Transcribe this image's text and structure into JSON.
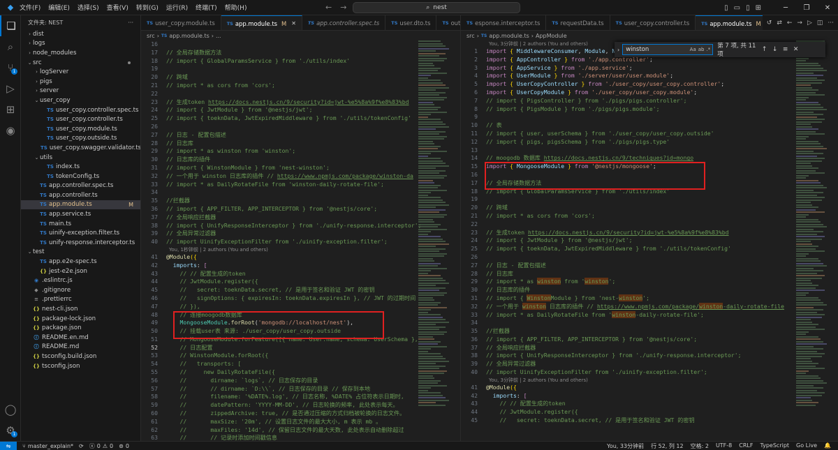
{
  "menu": [
    "文件(F)",
    "编辑(E)",
    "选择(S)",
    "查看(V)",
    "转到(G)",
    "运行(R)",
    "终端(T)",
    "帮助(H)"
  ],
  "search": {
    "text": "nest"
  },
  "explorer": {
    "title": "文件夹: NEST",
    "items": [
      {
        "label": "dist",
        "depth": 0,
        "kind": "folder",
        "open": false
      },
      {
        "label": "logs",
        "depth": 0,
        "kind": "folder",
        "open": false
      },
      {
        "label": "node_modules",
        "depth": 0,
        "kind": "folder",
        "open": false
      },
      {
        "label": "src",
        "depth": 0,
        "kind": "folder",
        "open": true,
        "dot": true
      },
      {
        "label": "logServer",
        "depth": 1,
        "kind": "folder",
        "open": false
      },
      {
        "label": "pigs",
        "depth": 1,
        "kind": "folder",
        "open": false
      },
      {
        "label": "server",
        "depth": 1,
        "kind": "folder",
        "open": false
      },
      {
        "label": "user_copy",
        "depth": 1,
        "kind": "folder",
        "open": true
      },
      {
        "label": "user_copy.controller.spec.ts",
        "depth": 2,
        "kind": "ts"
      },
      {
        "label": "user_copy.controller.ts",
        "depth": 2,
        "kind": "ts"
      },
      {
        "label": "user_copy.module.ts",
        "depth": 2,
        "kind": "ts"
      },
      {
        "label": "user_copy.outside.ts",
        "depth": 2,
        "kind": "ts"
      },
      {
        "label": "user_copy.swagger.validator.ts",
        "depth": 2,
        "kind": "ts"
      },
      {
        "label": "utils",
        "depth": 1,
        "kind": "folder",
        "open": true
      },
      {
        "label": "index.ts",
        "depth": 2,
        "kind": "ts"
      },
      {
        "label": "tokenConfig.ts",
        "depth": 2,
        "kind": "ts"
      },
      {
        "label": "app.controller.spec.ts",
        "depth": 1,
        "kind": "ts"
      },
      {
        "label": "app.controller.ts",
        "depth": 1,
        "kind": "ts"
      },
      {
        "label": "app.module.ts",
        "depth": 1,
        "kind": "ts",
        "selected": true,
        "flag": "M"
      },
      {
        "label": "app.service.ts",
        "depth": 1,
        "kind": "ts"
      },
      {
        "label": "main.ts",
        "depth": 1,
        "kind": "ts"
      },
      {
        "label": "uinify-exception.filter.ts",
        "depth": 1,
        "kind": "ts"
      },
      {
        "label": "unify-response.interceptor.ts",
        "depth": 1,
        "kind": "ts"
      },
      {
        "label": "test",
        "depth": 0,
        "kind": "folder",
        "open": true
      },
      {
        "label": "app.e2e-spec.ts",
        "depth": 1,
        "kind": "ts"
      },
      {
        "label": "jest-e2e.json",
        "depth": 1,
        "kind": "json"
      },
      {
        "label": ".eslintrc.js",
        "depth": 0,
        "kind": "eslint"
      },
      {
        "label": ".gitignore",
        "depth": 0,
        "kind": "git"
      },
      {
        "label": ".prettierrc",
        "depth": 0,
        "kind": "prettier"
      },
      {
        "label": "nest-cli.json",
        "depth": 0,
        "kind": "json"
      },
      {
        "label": "package-lock.json",
        "depth": 0,
        "kind": "json"
      },
      {
        "label": "package.json",
        "depth": 0,
        "kind": "json"
      },
      {
        "label": "README.en.md",
        "depth": 0,
        "kind": "md"
      },
      {
        "label": "README.md",
        "depth": 0,
        "kind": "md"
      },
      {
        "label": "tsconfig.build.json",
        "depth": 0,
        "kind": "json"
      },
      {
        "label": "tsconfig.json",
        "depth": 0,
        "kind": "json"
      }
    ]
  },
  "left_editor": {
    "tabs": [
      {
        "label": "user_copy.module.ts",
        "active": false,
        "italic": false
      },
      {
        "label": "app.module.ts",
        "active": true,
        "modified": "M"
      },
      {
        "label": "app.controller.spec.ts",
        "active": false,
        "italic": true
      },
      {
        "label": "user.dto.ts",
        "active": false
      },
      {
        "label": "outsid",
        "active": false
      }
    ],
    "breadcrumb": [
      "src",
      "app.module.ts",
      "..."
    ],
    "codelens": "You, 1秒钟前 | 2 authors (You and others)",
    "lines": [
      {
        "n": "16",
        "html": ""
      },
      {
        "n": "17",
        "html": "<span class='c'>// 全局存储数据方法</span>"
      },
      {
        "n": "18",
        "html": "<span class='c'>// import { GlobalParamsService } from './utils/index'</span>"
      },
      {
        "n": "19",
        "html": ""
      },
      {
        "n": "20",
        "html": "<span class='c'>// 跨域</span>"
      },
      {
        "n": "21",
        "html": "<span class='c'>// import * as cors from 'cors';</span>"
      },
      {
        "n": "22",
        "html": ""
      },
      {
        "n": "23",
        "html": "<span class='c'>// 生成token </span><span class='u'>https://docs.nestjs.cn/9/security?id=jwt-%e5%8a%9f%e8%83%bd</span>"
      },
      {
        "n": "24",
        "html": "<span class='c'>// import { JwtModule } from '@nestjs/jwt';</span>"
      },
      {
        "n": "25",
        "html": "<span class='c'>// import { toeknData, JwtExpiredMiddleware } from './utils/tokenConfig'</span>"
      },
      {
        "n": "26",
        "html": ""
      },
      {
        "n": "27",
        "html": "<span class='c'>// 日志 - 配置包描述</span>"
      },
      {
        "n": "28",
        "html": "<span class='c'>// 日志库</span>"
      },
      {
        "n": "29",
        "html": "<span class='c'>// import * as winston from 'winston';</span>"
      },
      {
        "n": "30",
        "html": "<span class='c'>// 日志库的插件</span>"
      },
      {
        "n": "31",
        "html": "<span class='c'>// import { WinstonModule } from 'nest-winston';</span>"
      },
      {
        "n": "32",
        "html": "<span class='c'>// 一个用于 winston 日志库的插件 // </span><span class='u'>https://www.npmjs.com/package/winston-da</span>"
      },
      {
        "n": "33",
        "html": "<span class='c'>// import * as DailyRotateFile from 'winston-daily-rotate-file';</span>"
      },
      {
        "n": "34",
        "html": ""
      },
      {
        "n": "35",
        "html": "<span class='c'>//拦截器</span>"
      },
      {
        "n": "36",
        "html": "<span class='c'>// import { APP_FILTER, APP_INTERCEPTOR } from '@nestjs/core';</span>"
      },
      {
        "n": "37",
        "html": "<span class='c'>// 全局响应拦截器</span>"
      },
      {
        "n": "38",
        "html": "<span class='c'>// import { UnifyResponseInterceptor } from './unify-response.interceptor';</span>"
      },
      {
        "n": "39",
        "html": "<span class='c'>// 全局异常过滤器</span>"
      },
      {
        "n": "40",
        "html": "<span class='c'>// import UinifyExceptionFilter from './uinify-exception.filter';</span>",
        "lens_after": true
      },
      {
        "n": "41",
        "html": "<span class='f'>@Module</span><span class='p'>({</span>"
      },
      {
        "n": "42",
        "html": "  <span class='v'>imports</span>: <span class='k'>[</span>"
      },
      {
        "n": "43",
        "html": "    <span class='c'>// // 配置生成的token</span>"
      },
      {
        "n": "44",
        "html": "    <span class='c'>// JwtModule.register({</span>"
      },
      {
        "n": "45",
        "html": "    <span class='c'>//   secret: toeknData.secret, // 是用于签名和验证 JWT 的密钥</span>"
      },
      {
        "n": "46",
        "html": "    <span class='c'>//   signOptions: { expiresIn: toeknData.expiresIn }, // JWT 的过期时间</span>"
      },
      {
        "n": "47",
        "html": "    <span class='c'>// }),</span>"
      },
      {
        "n": "48",
        "html": "    <span class='c'>// 连接moogodb数据库</span>"
      },
      {
        "n": "49",
        "html": "    <span class='t'>MongooseModule</span>.<span class='f'>forRoot</span>(<span class='s'>'mongodb://localhost/nest'</span>),"
      },
      {
        "n": "50",
        "html": "    <span class='c'>// 挂载user表 来源: ./user_copy/user_copy.outside</span>"
      },
      {
        "n": "51",
        "html": "    <span class='c'>// MongooseModule.forFeature([{ name: User.name, schema: UserSchema },</span>"
      },
      {
        "n": "52",
        "html": "    <span class='c'>// 日志配置</span>"
      },
      {
        "n": "53",
        "html": "    <span class='c'>// WinstonModule.forRoot({</span>"
      },
      {
        "n": "54",
        "html": "    <span class='c'>//   transports: [</span>"
      },
      {
        "n": "55",
        "html": "    <span class='c'>//     new DailyRotateFile({</span>"
      },
      {
        "n": "56",
        "html": "    <span class='c'>//       dirname: `logs`, // 日志保存的目录</span>"
      },
      {
        "n": "57",
        "html": "    <span class='c'>//       // dirname: `D:\\\\`, // 日志保存的目录 // 保存到本地</span>"
      },
      {
        "n": "58",
        "html": "    <span class='c'>//       filename: '%DATE%.log', // 日志名称, %DATE% 占位符表示日期时,</span>"
      },
      {
        "n": "59",
        "html": "    <span class='c'>//       datePattern: 'YYYY-MM-DD', // 日志轮换的频率, 此处表示每天。</span>"
      },
      {
        "n": "60",
        "html": "    <span class='c'>//       zippedArchive: true, // 是否通过压缩的方式归档被轮换的日志文件。</span>"
      },
      {
        "n": "61",
        "html": "    <span class='c'>//       maxSize: '20m', // 设置日志文件的最大大小, m 表示 mb 。</span>"
      },
      {
        "n": "62",
        "html": "    <span class='c'>//       maxFiles: '14d', // 保留日志文件的最大天数, 此处表示自动删除超过</span>"
      },
      {
        "n": "63",
        "html": "    <span class='c'>//       // 记录时添加时间戳信息</span>"
      }
    ]
  },
  "right_editor": {
    "tabs": [
      {
        "label": "esponse.interceptor.ts",
        "active": false
      },
      {
        "label": "requestData.ts",
        "active": false
      },
      {
        "label": "user_copy.controller.ts",
        "active": false
      },
      {
        "label": "app.module.ts",
        "active": true,
        "modified": "M"
      }
    ],
    "breadcrumb": [
      "src",
      "app.module.ts",
      "AppModule"
    ],
    "codelens_top": "You, 3分钟前 | 2 authors (You and others)",
    "codelens_mid": "You, 3分钟前 | 2 authors (You and others)",
    "find": {
      "query": "winston",
      "count": "第 7 项, 共 11 项"
    },
    "lines": [
      {
        "n": "1",
        "html": "<span class='k'>import</span> <span class='p'>{</span> <span class='v'>MiddlewareConsumer</span>, <span class='v'>Module</span>, <span class='v'>NestModule</span> <span class='p'>}</span> <span class='k'>from</span> <span class='s'>'@nestjs/common'</span>;"
      },
      {
        "n": "2",
        "html": "<span class='k'>import</span> <span class='p'>{</span> <span class='v'>AppController</span> <span class='p'>}</span> <span class='k'>from</span> <span class='s'>'./app.controller'</span>;"
      },
      {
        "n": "3",
        "html": "<span class='k'>import</span> <span class='p'>{</span> <span class='v'>AppService</span> <span class='p'>}</span> <span class='k'>from</span> <span class='s'>'./app.service'</span>;"
      },
      {
        "n": "4",
        "html": "<span class='k'>import</span> <span class='p'>{</span> <span class='v'>UserModule</span> <span class='p'>}</span> <span class='k'>from</span> <span class='s'>'./server/user/user.module'</span>;"
      },
      {
        "n": "5",
        "html": "<span class='k'>import</span> <span class='p'>{</span> <span class='v'>UserCopyController</span> <span class='p'>}</span> <span class='k'>from</span> <span class='s'>'./user_copy/user_copy.controller'</span>;"
      },
      {
        "n": "6",
        "html": "<span class='k'>import</span> <span class='p'>{</span> <span class='v'>UserCopyModule</span> <span class='p'>}</span> <span class='k'>from</span> <span class='s'>'./user_copy/user_copy.module'</span>;"
      },
      {
        "n": "7",
        "html": "<span class='c'>// import { PigsController } from './pigs/pigs.controller';</span>"
      },
      {
        "n": "8",
        "html": "<span class='c'>// import { PigsModule } from './pigs/pigs.module';</span>"
      },
      {
        "n": "9",
        "html": ""
      },
      {
        "n": "10",
        "html": "<span class='c'>// 表</span>"
      },
      {
        "n": "11",
        "html": "<span class='c'>// import { user, userSchema } from './user_copy/user_copy.outside'</span>"
      },
      {
        "n": "12",
        "html": "<span class='c'>// import { pigs, pigsSchema } from './pigs/pigs.type'</span>"
      },
      {
        "n": "13",
        "html": ""
      },
      {
        "n": "14",
        "html": "<span class='c'>// moogodb 数据库 </span><span class='u'>https://docs.nestjs.cn/9/techniques?id=mongo</span>"
      },
      {
        "n": "15",
        "html": "<span class='k'>import</span> <span class='p'>{</span> <span class='v'>MongooseModule</span> <span class='p'>}</span> <span class='k'>from</span> <span class='s'>'@nestjs/mongoose'</span>;"
      },
      {
        "n": "16",
        "html": ""
      },
      {
        "n": "17",
        "html": "<span class='c'>// 全局存储数据方法</span>"
      },
      {
        "n": "18",
        "html": "<span class='c'>// import { GlobalParamsService } from './utils/index'</span>"
      },
      {
        "n": "19",
        "html": ""
      },
      {
        "n": "20",
        "html": "<span class='c'>// 跨域</span>"
      },
      {
        "n": "21",
        "html": "<span class='c'>// import * as cors from 'cors';</span>"
      },
      {
        "n": "22",
        "html": ""
      },
      {
        "n": "23",
        "html": "<span class='c'>// 生成token </span><span class='u'>https://docs.nestjs.cn/9/security?id=jwt-%e5%8a%9f%e8%83%bd</span>"
      },
      {
        "n": "24",
        "html": "<span class='c'>// import { JwtModule } from '@nestjs/jwt';</span>"
      },
      {
        "n": "25",
        "html": "<span class='c'>// import { toeknData, JwtExpiredMiddleware } from './utils/tokenConfig'</span>"
      },
      {
        "n": "26",
        "html": ""
      },
      {
        "n": "27",
        "html": "<span class='c'>// 日志 - 配置包描述</span>"
      },
      {
        "n": "28",
        "html": "<span class='c'>// 日志库</span>"
      },
      {
        "n": "29",
        "html": "<span class='c'>// import * as </span><span class='c hl'>winston</span><span class='c'> from '</span><span class='c hl'>winston</span><span class='c'>';</span>"
      },
      {
        "n": "30",
        "html": "<span class='c'>// 日志库的插件</span>"
      },
      {
        "n": "31",
        "html": "<span class='c'>// import { </span><span class='c hl'>Winston</span><span class='c'>Module } from 'nest-</span><span class='c hl'>winston</span><span class='c'>';</span>"
      },
      {
        "n": "32",
        "html": "<span class='c'>// 一个用于 </span><span class='c hl'>winston</span><span class='c'> 日志库的插件 // </span><span class='u'>https://www.npmjs.com/package/</span><span class='u hl'>winston</span><span class='u'>-daily-rotate-file</span>"
      },
      {
        "n": "33",
        "html": "<span class='c'>// import * as DailyRotateFile from '</span><span class='c hl'>winston</span><span class='c'>-daily-rotate-file';</span>"
      },
      {
        "n": "34",
        "html": ""
      },
      {
        "n": "35",
        "html": "<span class='c'>//拦截器</span>"
      },
      {
        "n": "36",
        "html": "<span class='c'>// import { APP_FILTER, APP_INTERCEPTOR } from '@nestjs/core';</span>"
      },
      {
        "n": "37",
        "html": "<span class='c'>// 全局响应拦截器</span>"
      },
      {
        "n": "38",
        "html": "<span class='c'>// import { UnifyResponseInterceptor } from './unify-response.interceptor';</span>"
      },
      {
        "n": "39",
        "html": "<span class='c'>// 全局异常过滤器</span>"
      },
      {
        "n": "40",
        "html": "<span class='c'>// import UinifyExceptionFilter from './uinify-exception.filter';</span>",
        "lens_after": true
      },
      {
        "n": "41",
        "html": "<span class='f'>@Module</span><span class='p'>({</span>"
      },
      {
        "n": "42",
        "html": "  <span class='v'>imports</span>: <span class='k'>[</span>"
      },
      {
        "n": "43",
        "html": "    <span class='c'>// // 配置生成的token</span>"
      },
      {
        "n": "44",
        "html": "    <span class='c'>// JwtModule.register({</span>"
      },
      {
        "n": "45",
        "html": "    <span class='c'>//   secret: toeknData.secret, // 是用于签名和验证 JWT 的密钥</span>"
      }
    ]
  },
  "status": {
    "branch": "master_explain*",
    "sync": "⟳",
    "errors": "0",
    "warnings": "0",
    "ports": "0",
    "blame": "You, 33分钟前",
    "position": "行 52, 列 12",
    "spaces": "空格: 2",
    "encoding": "UTF-8",
    "eol": "CRLF",
    "language": "TypeScript",
    "golive": "Go Live"
  }
}
